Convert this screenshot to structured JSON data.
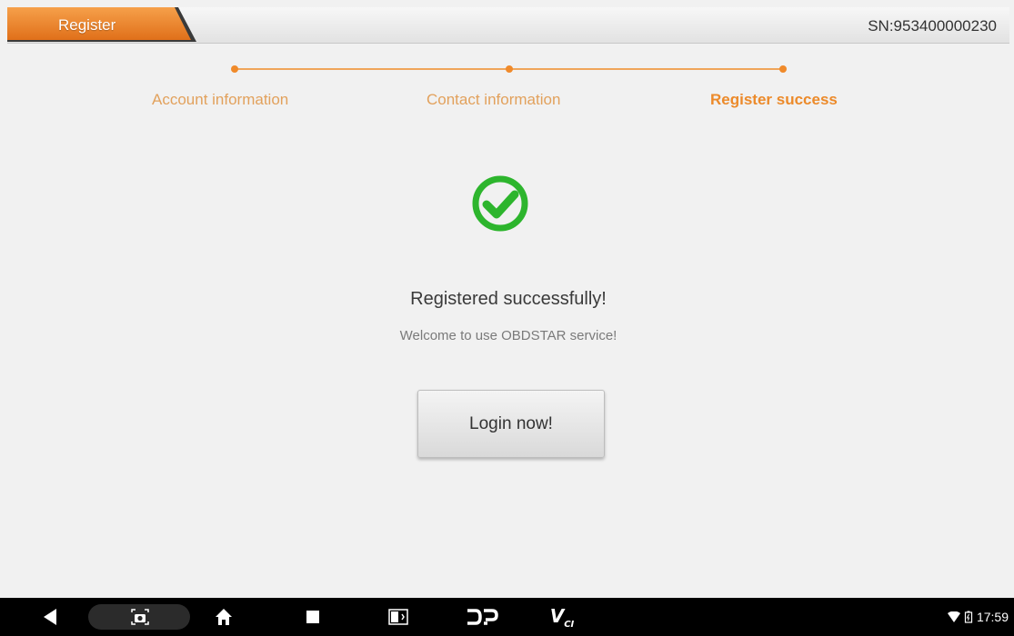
{
  "header": {
    "tab_label": "Register",
    "serial": "SN:953400000230"
  },
  "steps": [
    {
      "label": "Account information",
      "active": false
    },
    {
      "label": "Contact information",
      "active": false
    },
    {
      "label": "Register success",
      "active": true
    }
  ],
  "success": {
    "icon": "check-circle-icon",
    "title": "Registered successfully!",
    "subtitle": "Welcome to use OBDSTAR service!",
    "button_label": "Login now!"
  },
  "navbar": {
    "items": [
      "back-icon",
      "screenshot-icon",
      "home-icon",
      "recents-icon",
      "display-icon",
      "dp-icon",
      "vci-icon"
    ],
    "vci_label": "V",
    "vci_sub": "CI"
  },
  "status": {
    "time": "17:59"
  },
  "colors": {
    "accent": "#ec8a2a",
    "success": "#2db52d",
    "navbar": "#000000",
    "background": "#f1f1f1"
  }
}
